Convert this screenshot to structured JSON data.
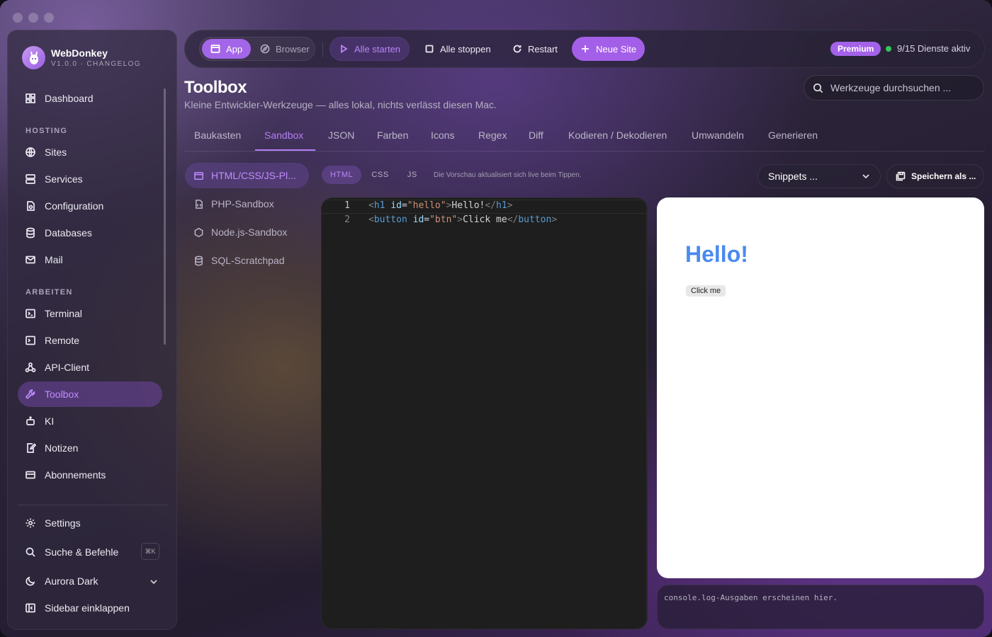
{
  "app": {
    "name": "WebDonkey",
    "version": "V1.0.0 · CHANGELOG"
  },
  "sidebar": {
    "top": [
      {
        "label": "Dashboard",
        "icon": "dashboard-icon"
      }
    ],
    "sections": [
      {
        "title": "HOSTING",
        "items": [
          {
            "label": "Sites",
            "icon": "globe-icon"
          },
          {
            "label": "Services",
            "icon": "server-icon"
          },
          {
            "label": "Configuration",
            "icon": "file-settings-icon"
          },
          {
            "label": "Databases",
            "icon": "database-icon"
          },
          {
            "label": "Mail",
            "icon": "mail-icon"
          }
        ]
      },
      {
        "title": "ARBEITEN",
        "items": [
          {
            "label": "Terminal",
            "icon": "terminal-icon"
          },
          {
            "label": "Remote",
            "icon": "remote-terminal-icon"
          },
          {
            "label": "API-Client",
            "icon": "api-icon"
          },
          {
            "label": "Toolbox",
            "icon": "wrench-icon",
            "active": true
          },
          {
            "label": "KI",
            "icon": "robot-icon"
          },
          {
            "label": "Notizen",
            "icon": "note-icon"
          },
          {
            "label": "Abonnements",
            "icon": "card-icon"
          }
        ]
      }
    ],
    "footer": {
      "settings": "Settings",
      "search": "Suche & Befehle",
      "search_shortcut": "⌘K",
      "theme": "Aurora Dark",
      "collapse": "Sidebar einklappen"
    }
  },
  "toolbar": {
    "app": "App",
    "browser": "Browser",
    "start_all": "Alle starten",
    "stop_all": "Alle stoppen",
    "restart": "Restart",
    "new_site": "Neue Site",
    "badge": "Premium",
    "status": "9/15 Dienste aktiv",
    "status_color": "#34c759",
    "accent": "#a366e8"
  },
  "page": {
    "title": "Toolbox",
    "subtitle": "Kleine Entwickler-Werkzeuge — alles lokal, nichts verlässt diesen Mac.",
    "search_placeholder": "Werkzeuge durchsuchen ..."
  },
  "tabs": [
    {
      "label": "Baukasten"
    },
    {
      "label": "Sandbox",
      "active": true
    },
    {
      "label": "JSON"
    },
    {
      "label": "Farben"
    },
    {
      "label": "Icons"
    },
    {
      "label": "Regex"
    },
    {
      "label": "Diff"
    },
    {
      "label": "Kodieren / Dekodieren"
    },
    {
      "label": "Umwandeln"
    },
    {
      "label": "Generieren"
    }
  ],
  "sandbox": {
    "items": [
      {
        "label": "HTML/CSS/JS-Pl...",
        "icon": "window-icon",
        "active": true
      },
      {
        "label": "PHP-Sandbox",
        "icon": "php-file-icon"
      },
      {
        "label": "Node.js-Sandbox",
        "icon": "hexagon-icon"
      },
      {
        "label": "SQL-Scratchpad",
        "icon": "database-icon"
      }
    ],
    "langs": [
      "HTML",
      "CSS",
      "JS"
    ],
    "active_lang": "HTML",
    "live_hint": "Die Vorschau aktualisiert sich live beim Tippen.",
    "snippets": "Snippets ...",
    "save_as": "Speichern als ..."
  },
  "editor": {
    "lines": [
      {
        "num": "1",
        "tokens": [
          [
            "brk",
            "<"
          ],
          [
            "tag",
            "h1"
          ],
          [
            "txt",
            " "
          ],
          [
            "attr",
            "id"
          ],
          [
            "eq",
            "="
          ],
          [
            "str",
            "\"hello\""
          ],
          [
            "brk",
            ">"
          ],
          [
            "txt",
            "Hello!"
          ],
          [
            "brk",
            "</"
          ],
          [
            "tag",
            "h1"
          ],
          [
            "brk",
            ">"
          ]
        ]
      },
      {
        "num": "2",
        "tokens": [
          [
            "brk",
            "<"
          ],
          [
            "tag",
            "button"
          ],
          [
            "txt",
            " "
          ],
          [
            "attr",
            "id"
          ],
          [
            "eq",
            "="
          ],
          [
            "str",
            "\"btn\""
          ],
          [
            "brk",
            ">"
          ],
          [
            "txt",
            "Click me"
          ],
          [
            "brk",
            "</"
          ],
          [
            "tag",
            "button"
          ],
          [
            "brk",
            ">"
          ]
        ]
      }
    ]
  },
  "preview": {
    "heading": "Hello!",
    "heading_color": "#4a8af0",
    "button": "Click me"
  },
  "console": {
    "placeholder": "console.log-Ausgaben erscheinen hier."
  }
}
